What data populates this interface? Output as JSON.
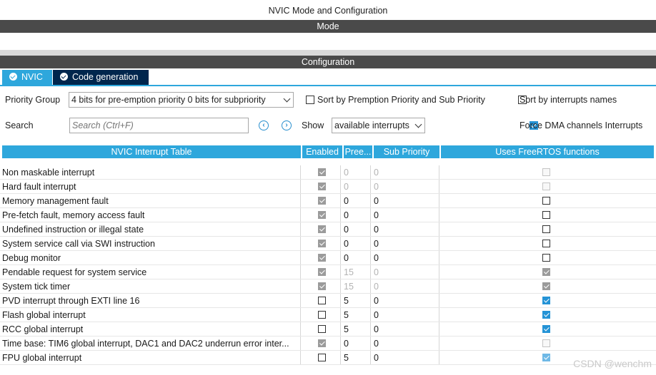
{
  "window": {
    "title": "NVIC Mode and Configuration",
    "mode_label": "Mode",
    "configuration_label": "Configuration"
  },
  "tabs": [
    {
      "label": "NVIC",
      "icon": "check-circle-icon",
      "active": true
    },
    {
      "label": "Code generation",
      "icon": "check-circle-icon",
      "active": false
    }
  ],
  "controls": {
    "priority_group_label": "Priority Group",
    "priority_group_value": "4 bits for pre-emption priority 0 bits for subpriority",
    "sort_premption_label": "Sort by Premption Priority and Sub Priority",
    "sort_premption_checked": false,
    "sort_names_label": "Sort by interrupts names",
    "sort_names_checked": false,
    "search_label": "Search",
    "search_placeholder": "Search (Ctrl+F)",
    "show_label": "Show",
    "show_value": "available interrupts",
    "force_dma_label": "Force DMA channels Interrupts",
    "force_dma_checked": true
  },
  "table": {
    "headers": [
      "NVIC Interrupt Table",
      "Enabled",
      "Pree...",
      "Sub Priority",
      "Uses FreeRTOS functions"
    ],
    "rows": [
      {
        "name": "Non maskable interrupt",
        "enabled": "on-dis",
        "pre": "0",
        "sub": "0",
        "pre_grey": true,
        "rtos": "off-dis"
      },
      {
        "name": "Hard fault interrupt",
        "enabled": "on-dis",
        "pre": "0",
        "sub": "0",
        "pre_grey": true,
        "rtos": "off-dis"
      },
      {
        "name": "Memory management fault",
        "enabled": "on-dis",
        "pre": "0",
        "sub": "0",
        "pre_grey": false,
        "rtos": "off"
      },
      {
        "name": "Pre-fetch fault, memory access fault",
        "enabled": "on-dis",
        "pre": "0",
        "sub": "0",
        "pre_grey": false,
        "rtos": "off"
      },
      {
        "name": "Undefined instruction or illegal state",
        "enabled": "on-dis",
        "pre": "0",
        "sub": "0",
        "pre_grey": false,
        "rtos": "off"
      },
      {
        "name": "System service call via SWI instruction",
        "enabled": "on-dis",
        "pre": "0",
        "sub": "0",
        "pre_grey": false,
        "rtos": "off"
      },
      {
        "name": "Debug monitor",
        "enabled": "on-dis",
        "pre": "0",
        "sub": "0",
        "pre_grey": false,
        "rtos": "off"
      },
      {
        "name": "Pendable request for system service",
        "enabled": "on-dis",
        "pre": "15",
        "sub": "0",
        "pre_grey": true,
        "rtos": "on-dis"
      },
      {
        "name": "System tick timer",
        "enabled": "on-dis",
        "pre": "15",
        "sub": "0",
        "pre_grey": true,
        "rtos": "on-dis"
      },
      {
        "name": "PVD interrupt through EXTI line 16",
        "enabled": "off",
        "pre": "5",
        "sub": "0",
        "pre_grey": false,
        "rtos": "on"
      },
      {
        "name": "Flash global interrupt",
        "enabled": "off",
        "pre": "5",
        "sub": "0",
        "pre_grey": false,
        "rtos": "on"
      },
      {
        "name": "RCC global interrupt",
        "enabled": "off",
        "pre": "5",
        "sub": "0",
        "pre_grey": false,
        "rtos": "on"
      },
      {
        "name": "Time base: TIM6 global interrupt, DAC1 and DAC2 underrun error inter...",
        "enabled": "on-dis",
        "pre": "0",
        "sub": "0",
        "pre_grey": false,
        "rtos": "off-dis"
      },
      {
        "name": "FPU global interrupt",
        "enabled": "off",
        "pre": "5",
        "sub": "0",
        "pre_grey": false,
        "rtos": "on-light"
      }
    ]
  },
  "watermark": "CSDN @wenchm",
  "colors": {
    "accent": "#2ea7dc",
    "tab_dark": "#00264d",
    "bar_dark": "#4a4a4a",
    "check_blue": "#2493d6"
  }
}
